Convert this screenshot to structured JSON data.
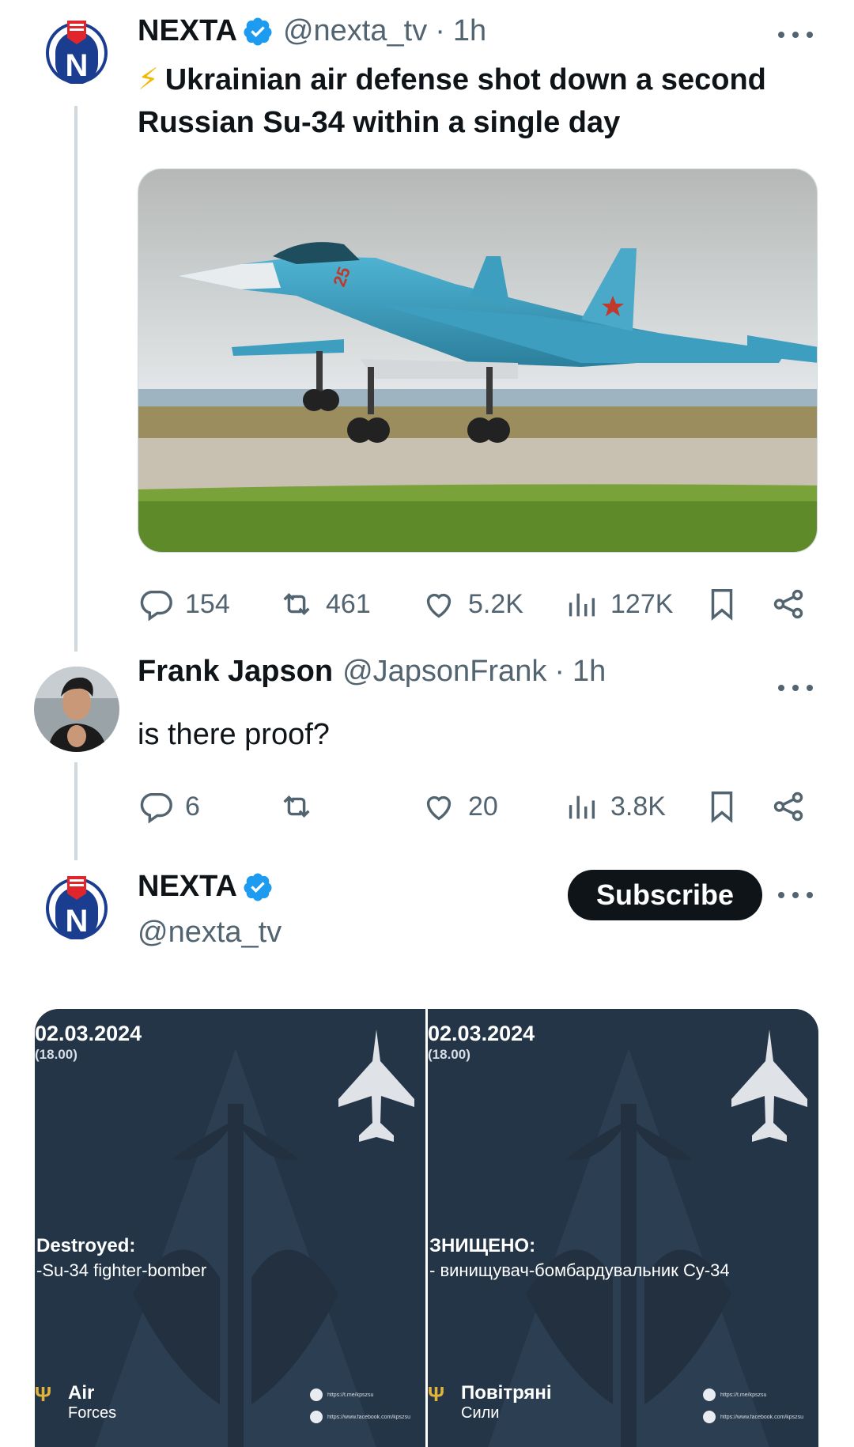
{
  "colors": {
    "verified": "#1d9bf0",
    "text_primary": "#0f1419",
    "text_secondary": "#536471",
    "thread_line": "#cfd9de",
    "card_bg": "#253548",
    "subscribe_bg": "#0f1419"
  },
  "tweet1": {
    "display_name": "NEXTA",
    "handle": "@nexta_tv",
    "separator": "·",
    "time": "1h",
    "bolt": "⚡",
    "text": "Ukrainian air defense shot down a second Russian Su-34 within a single day",
    "stats": {
      "replies": "154",
      "reposts": "461",
      "likes": "5.2K",
      "views": "127K"
    }
  },
  "reply": {
    "display_name": "Frank Japson",
    "handle": "@JapsonFrank",
    "separator": "·",
    "time": "1h",
    "text": "is there proof?",
    "stats": {
      "replies": "6",
      "reposts": "",
      "likes": "20",
      "views": "3.8K"
    }
  },
  "tweet2": {
    "display_name": "NEXTA",
    "handle": "@nexta_tv",
    "subscribe_label": "Subscribe"
  },
  "card_left": {
    "date": "02.03.2024",
    "time": "(18.00)",
    "label1": "Destroyed:",
    "label2": "-Su-34 fighter-bomber",
    "footer_trident": "Ψ",
    "footer_line1": "Air",
    "footer_line2": "Forces",
    "link1": "https://t.me/kpszsu",
    "link2": "https://www.facebook.com/kpszsu"
  },
  "card_right": {
    "date": "02.03.2024",
    "time": "(18.00)",
    "label1": "ЗНИЩЕНО:",
    "label2": "- винищувач-бомбардувальник Су-34",
    "footer_trident": "Ψ",
    "footer_line1": "Повітряні",
    "footer_line2": "Сили",
    "link1": "https://t.me/kpszsu",
    "link2": "https://www.facebook.com/kpszsu"
  }
}
